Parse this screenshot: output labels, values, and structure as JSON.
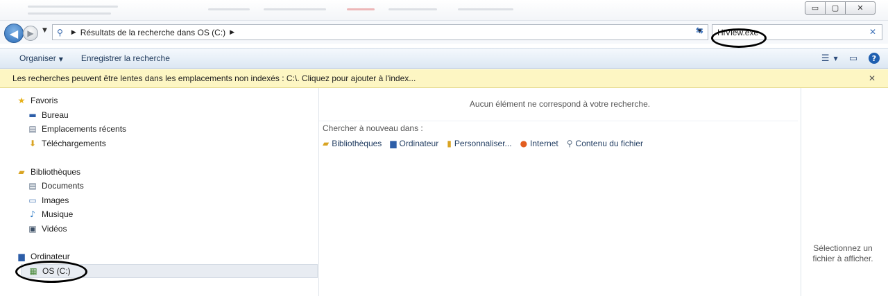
{
  "window": {
    "buttons": {
      "minimize": "▭",
      "maximize": "▢",
      "close": "✕"
    }
  },
  "address_bar": {
    "back_icon": "arrow-left-icon",
    "forward_icon": "arrow-right-icon",
    "path": "Résultats de la recherche dans OS (C:)",
    "search_value": "HiView.exe"
  },
  "command_bar": {
    "organise": "Organiser",
    "save_search": "Enregistrer la recherche"
  },
  "info_bar": {
    "message": "Les recherches peuvent être lentes dans les emplacements non indexés : C:\\. Cliquez pour ajouter à l'index..."
  },
  "nav_tree": {
    "favorites": {
      "label": "Favoris",
      "items": [
        "Bureau",
        "Emplacements récents",
        "Téléchargements"
      ]
    },
    "libraries": {
      "label": "Bibliothèques",
      "items": [
        "Documents",
        "Images",
        "Musique",
        "Vidéos"
      ]
    },
    "computer": {
      "label": "Ordinateur",
      "items": [
        "OS (C:)"
      ]
    }
  },
  "content": {
    "no_results": "Aucun élément ne correspond à votre recherche.",
    "search_again_label": "Chercher à nouveau dans :",
    "search_again_links": [
      "Bibliothèques",
      "Ordinateur",
      "Personnaliser...",
      "Internet",
      "Contenu du fichier"
    ]
  },
  "preview": {
    "message": "Sélectionnez un fichier à afficher."
  },
  "colors": {
    "accent": "#2a6ab6",
    "info_bar": "#fdf6c3",
    "command_bar": "#dce7f3"
  }
}
